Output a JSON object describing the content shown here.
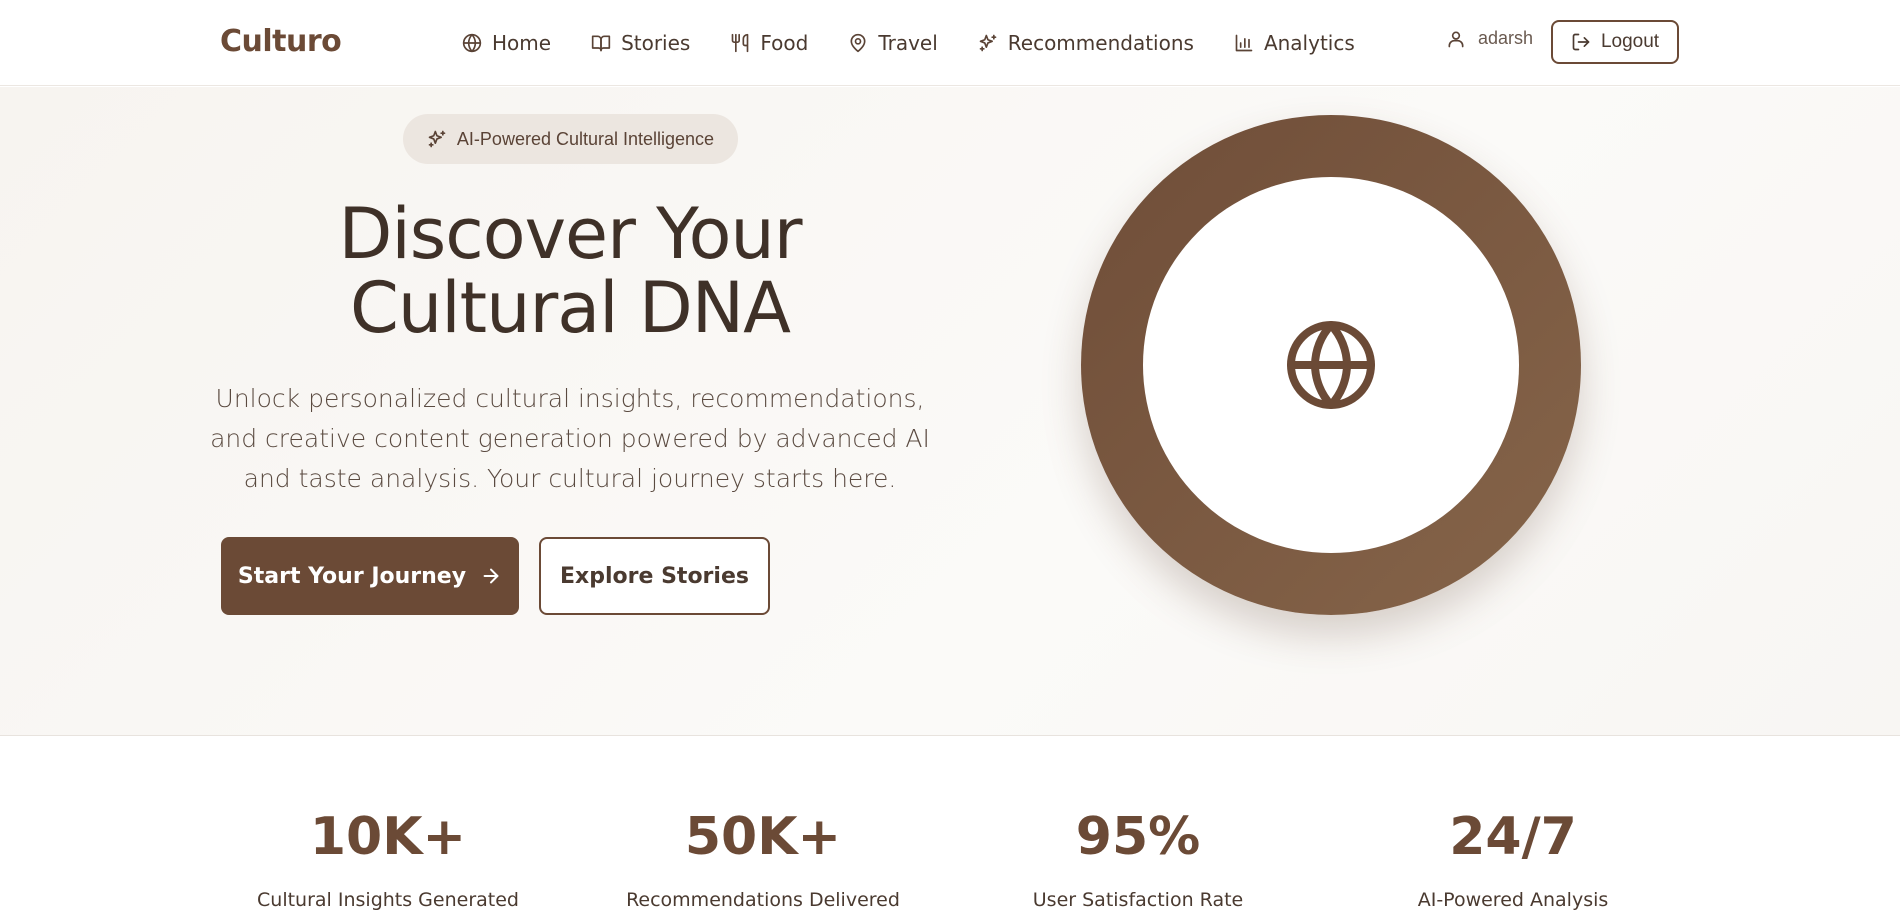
{
  "brand": "Culturo",
  "nav": [
    {
      "label": "Home",
      "icon": "globe-icon"
    },
    {
      "label": "Stories",
      "icon": "book-icon"
    },
    {
      "label": "Food",
      "icon": "utensils-icon"
    },
    {
      "label": "Travel",
      "icon": "map-pin-icon"
    },
    {
      "label": "Recommendations",
      "icon": "sparkles-icon"
    },
    {
      "label": "Analytics",
      "icon": "bar-chart-icon"
    }
  ],
  "user": {
    "name": "adarsh",
    "icon": "user-icon"
  },
  "logout_label": "Logout",
  "hero": {
    "badge": "AI-Powered Cultural Intelligence",
    "title_line1": "Discover Your",
    "title_line2": "Cultural DNA",
    "description": "Unlock personalized cultural insights, recommendations, and creative content generation powered by advanced AI and taste analysis. Your cultural journey starts here.",
    "primary_button": "Start Your Journey",
    "secondary_button": "Explore Stories"
  },
  "stats": [
    {
      "value": "10K+",
      "label": "Cultural Insights Generated"
    },
    {
      "value": "50K+",
      "label": "Recommendations Delivered"
    },
    {
      "value": "95%",
      "label": "User Satisfaction Rate"
    },
    {
      "value": "24/7",
      "label": "AI-Powered Analysis"
    }
  ],
  "colors": {
    "brand": "#6b4a36",
    "text": "#3f3128",
    "badge_bg": "#ece6e0",
    "hero_bg": "#f7f4f0"
  }
}
